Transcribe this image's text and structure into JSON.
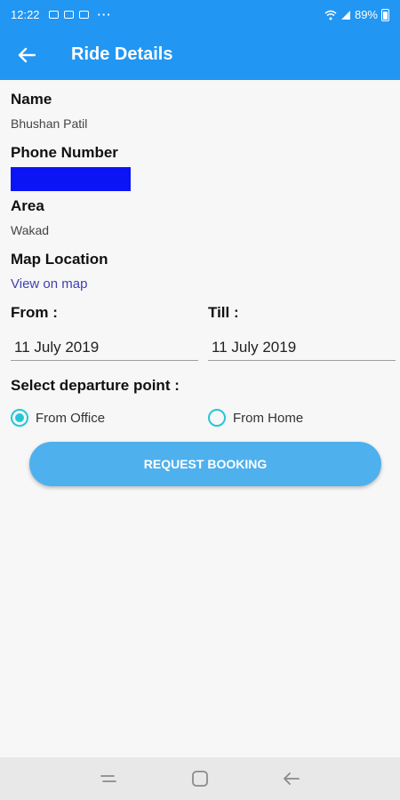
{
  "status_bar": {
    "time": "12:22",
    "more": "···",
    "battery": "89%"
  },
  "app_bar": {
    "back_icon": "arrow-left-icon",
    "title": "Ride Details"
  },
  "details": {
    "name_label": "Name",
    "name_value": "Bhushan Patil",
    "phone_label": "Phone Number",
    "area_label": "Area",
    "area_value": "Wakad",
    "map_label": "Map Location",
    "map_link": "View on map"
  },
  "dates": {
    "from_label": "From :",
    "from_value": "11 July 2019",
    "till_label": "Till :",
    "till_value": "11 July 2019"
  },
  "departure": {
    "label": "Select departure point :",
    "options": [
      {
        "label": "From Office",
        "selected": true
      },
      {
        "label": "From Home",
        "selected": false
      }
    ]
  },
  "request_button": "REQUEST BOOKING",
  "colors": {
    "primary": "#2196f3",
    "button": "#4fb0ee",
    "radio": "#26c6da",
    "redaction": "#0a14f5"
  }
}
